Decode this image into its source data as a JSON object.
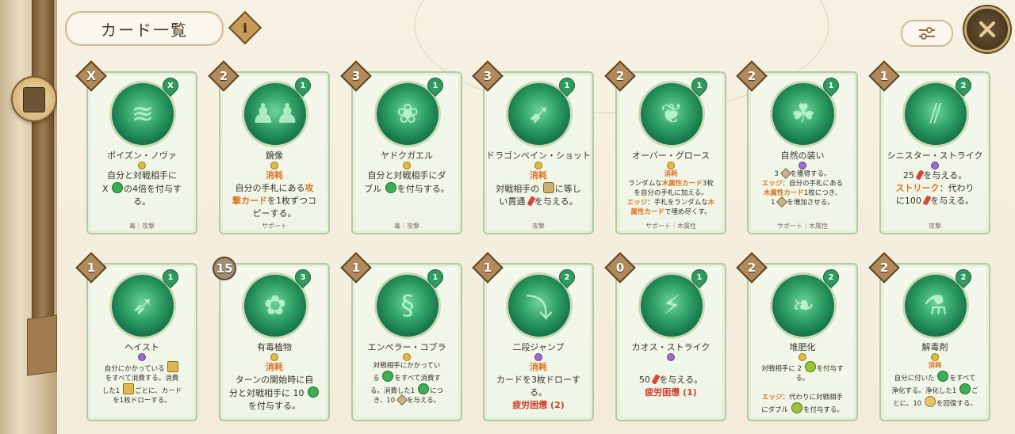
{
  "header": {
    "title": "カード一覧",
    "info_label": "i"
  },
  "cards_row1": [
    {
      "cost": "X",
      "upgrade": "X",
      "name": "ポイズン・ノヴァ",
      "gem": "gold",
      "desc_html": "自分と対戦相手に<br>X <span class='ico poison'></span>の4倍を付与す<br>る。",
      "tags": "毒｜攻撃",
      "glyph": "≋"
    },
    {
      "cost": "2",
      "upgrade": "1",
      "name": "鏡像",
      "gem": "gold",
      "desc_html": "<span class='kw'>消耗</span><br>自分の手札にある<span class='kw'>攻<br>撃カード</span>を1枚ずつコ<br>ピーする。",
      "tags": "サポート",
      "glyph": "♟♟"
    },
    {
      "cost": "3",
      "upgrade": "1",
      "name": "ヤドクガエル",
      "gem": "gold",
      "desc_html": "自分と対戦相手にダ<br>ブル <span class='ico poison'></span>を付与する。",
      "tags": "毒｜攻撃",
      "glyph": "❀"
    },
    {
      "cost": "3",
      "upgrade": "1",
      "name": "ドラゴンベイン・ショット",
      "gem": "gold",
      "desc_html": "<span class='kw'>消耗</span><br>対戦相手の <span class='ico shield'></span>に等し<br>い貫通 <span class='ico dmg'></span>を与える。",
      "tags": "攻撃",
      "glyph": "➹"
    },
    {
      "cost": "2",
      "upgrade": "1",
      "name": "オーバー・グロース",
      "gem": "gold",
      "small": true,
      "desc_html": "<span class='kw'>消耗</span><br>ランダムな<span class='kw'>木属性カード</span>3枚<br>を自分の手札に加える。<br><span class='kw'>エッジ</span>：手札をランダムな<span class='kw'>木<br>属性カード</span>で埋め尽くす。",
      "tags": "サポート｜木属性",
      "glyph": "❦"
    },
    {
      "cost": "2",
      "upgrade": "1",
      "name": "自然の装い",
      "gem": "purple",
      "small": true,
      "desc_html": "3 <span class='ico energy'></span>を獲得する。<br><span class='kw'>エッジ</span>：自分の手札にある<br><span class='kw'>木属性カード</span>1枚につき、<br>1 <span class='ico energy'></span>を増加させる。",
      "tags": "サポート｜木属性",
      "glyph": "☘"
    },
    {
      "cost": "1",
      "upgrade": "2",
      "name": "シニスター・ストライク",
      "gem": "purple",
      "desc_html": "25 <span class='ico dmg'></span>を与える。<br><span class='kw'>ストリーク</span>：代わり<br>に100 <span class='ico dmg'></span>を与える。",
      "tags": "攻撃",
      "glyph": "⫽"
    }
  ],
  "cards_row2": [
    {
      "cost": "1",
      "upgrade": "1",
      "name": "ヘイスト",
      "gem": "purple",
      "small": true,
      "desc_html": "自分にかかっている <span class='ico haste'></span><br>をすべて消費する。消費<br>した1 <span class='ico haste'></span>ごとに、カード<br>を1枚ドローする。",
      "glyph": "➶"
    },
    {
      "cost": "15",
      "round": true,
      "upgrade": "3",
      "name": "有毒植物",
      "gem": "gold",
      "desc_html": "<span class='kw'>消耗</span><br>ターンの開始時に自<br>分と対戦相手に 10 <span class='ico poison'></span><br>を付与する。",
      "glyph": "✿"
    },
    {
      "cost": "1",
      "upgrade": "1",
      "name": "エンペラー・コブラ",
      "gem": "gold",
      "small": true,
      "desc_html": "対戦相手にかかってい<br>る <span class='ico poison'></span>をすべて消費す<br>る。消費した1 <span class='ico poison'></span>につ<br>き、10 <span class='ico energy'></span>を与える。",
      "glyph": "§"
    },
    {
      "cost": "1",
      "upgrade": "2",
      "name": "二段ジャンプ",
      "gem": "purple",
      "desc_html": "<span class='kw'>消耗</span><br>カードを3枚ドローす<br>る。<br><span class='red'>疲労困憊 (2)</span>",
      "glyph": "⤵"
    },
    {
      "cost": "0",
      "upgrade": "1",
      "name": "カオス・ストライク",
      "gem": "purple",
      "desc_html": "<br>50 <span class='ico dmg'></span>を与える。<br><span class='red'>疲労困憊 (1)</span>",
      "glyph": "⚡"
    },
    {
      "cost": "2",
      "upgrade": "2",
      "name": "堆肥化",
      "gem": "gold",
      "small": true,
      "desc_html": "対戦相手に 2 <span class='ico sprout'></span>を付与する。<br><br><span class='kw'>エッジ</span>：代わりに対戦相手<br>にダブル <span class='ico sprout'></span>を付与する。",
      "glyph": "❧"
    },
    {
      "cost": "2",
      "upgrade": "2",
      "name": "解毒剤",
      "gem": "gold",
      "small": true,
      "desc_html": "<span class='kw'>消耗</span><br>自分に付いた <span class='ico poison'></span>をすべて<br>浄化する。浄化した1 <span class='ico poison'></span>ご<br>とに、10 <span class='ico heart'></span>を回復する。",
      "glyph": "⚗"
    }
  ]
}
